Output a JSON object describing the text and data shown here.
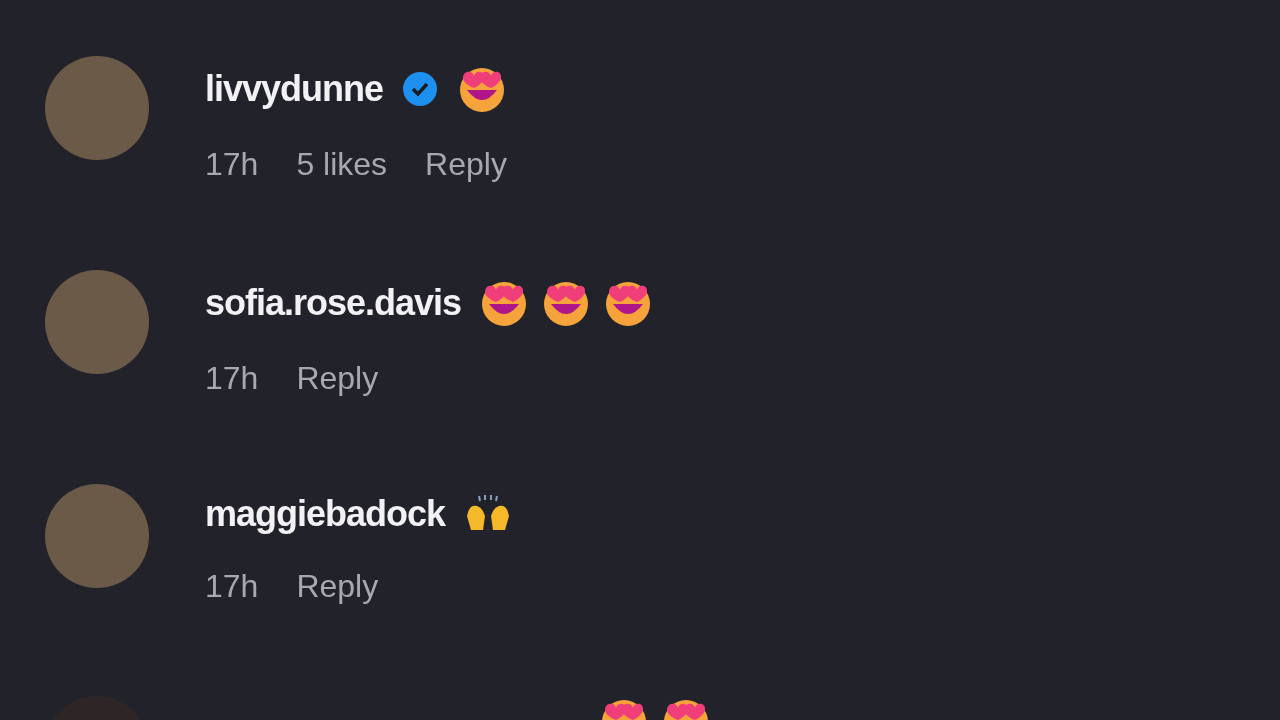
{
  "comments": [
    {
      "username": "livvydunne",
      "verified": true,
      "emojis": [
        {
          "kind": "heart_eyes"
        }
      ],
      "time": "17h",
      "likes": "5 likes",
      "reply": "Reply"
    },
    {
      "username": "sofia.rose.davis",
      "verified": false,
      "emojis": [
        {
          "kind": "heart_eyes"
        },
        {
          "kind": "heart_eyes"
        },
        {
          "kind": "heart_eyes"
        }
      ],
      "time": "17h",
      "reply": "Reply"
    },
    {
      "username": "maggiebadock",
      "verified": false,
      "emojis": [
        {
          "kind": "raising_hands"
        }
      ],
      "time": "17h",
      "reply": "Reply"
    }
  ],
  "cut_comment": {
    "emojis": [
      {
        "kind": "heart_eyes"
      },
      {
        "kind": "heart_eyes"
      }
    ]
  }
}
